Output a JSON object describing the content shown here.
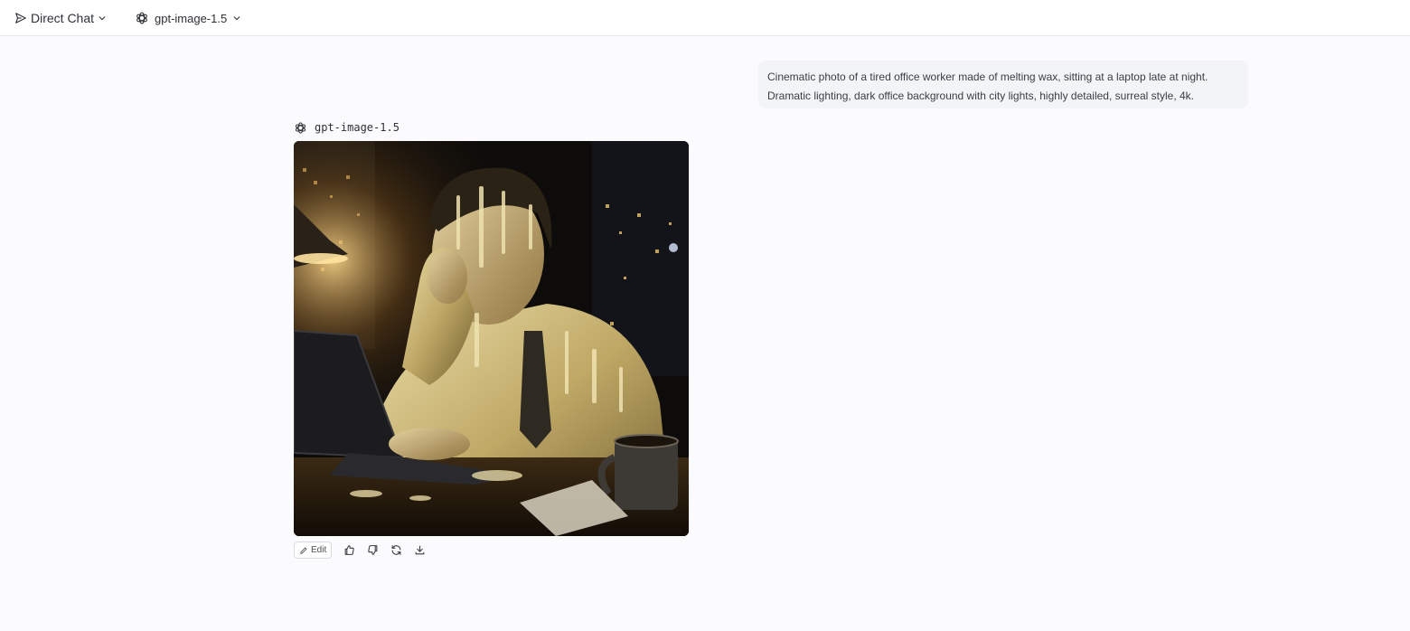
{
  "topbar": {
    "mode_label": "Direct Chat",
    "mode_icon": "send-icon",
    "model_label": "gpt-image-1.5",
    "model_icon": "openai-logo-icon"
  },
  "conversation": {
    "user_message": {
      "line1": "Cinematic photo of a tired office worker made of melting wax, sitting at a laptop late at night.",
      "line2": "Dramatic lighting, dark office background with city lights, highly detailed, surreal style, 4k."
    },
    "assistant": {
      "model_name": "gpt-image-1.5",
      "image_subject": "wax-melting office worker at laptop",
      "actions": {
        "edit_label": "Edit",
        "icons": [
          "pencil-icon",
          "thumbs-up-icon",
          "thumbs-down-icon",
          "regenerate-icon",
          "download-icon"
        ]
      }
    }
  },
  "colors": {
    "background": "#fbfbfd",
    "topbar_border": "#e6e7ea",
    "user_bubble": "#f3f4f8",
    "wax": "#d8c890"
  }
}
